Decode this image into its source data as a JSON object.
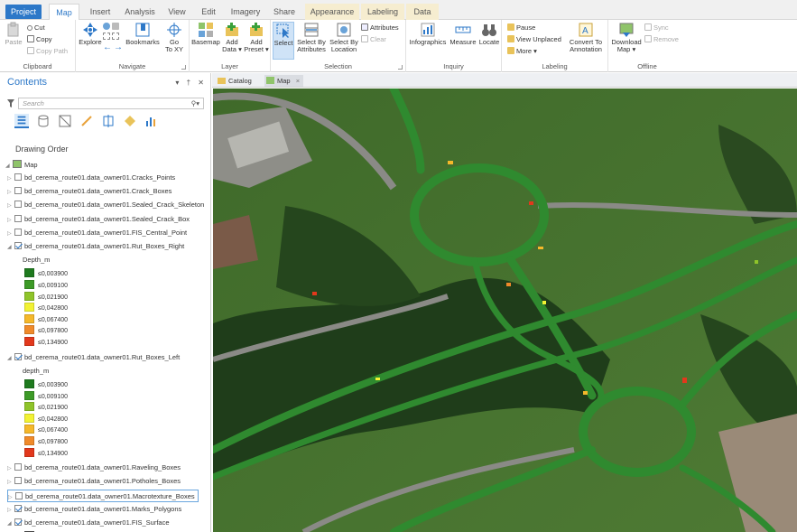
{
  "ribbon": {
    "tabs": [
      "Project",
      "Map",
      "Insert",
      "Analysis",
      "View",
      "Edit",
      "Imagery",
      "Share",
      "Appearance",
      "Labeling",
      "Data"
    ],
    "clipboard": {
      "paste": "Paste",
      "cut": "Cut",
      "copy": "Copy",
      "copy_path": "Copy Path",
      "label": "Clipboard"
    },
    "navigate": {
      "explore": "Explore",
      "bookmarks": "Bookmarks",
      "go_to_xy_1": "Go",
      "go_to_xy_2": "To XY",
      "label": "Navigate"
    },
    "layer": {
      "basemap": "Basemap",
      "add_data_1": "Add",
      "add_data_2": "Data ▾",
      "add_preset_1": "Add",
      "add_preset_2": "Preset ▾",
      "label": "Layer"
    },
    "selection": {
      "select": "Select",
      "select_by_attr_1": "Select By",
      "select_by_attr_2": "Attributes",
      "select_by_loc_1": "Select By",
      "select_by_loc_2": "Location",
      "attributes": "Attributes",
      "clear": "Clear",
      "label": "Selection"
    },
    "inquiry": {
      "infographics": "Infographics",
      "measure": "Measure",
      "locate": "Locate",
      "label": "Inquiry"
    },
    "labeling": {
      "pause": "Pause",
      "view_unplaced": "View Unplaced",
      "more": "More ▾",
      "convert_1": "Convert To",
      "convert_2": "Annotation",
      "label": "Labeling"
    },
    "offline": {
      "download_1": "Download",
      "download_2": "Map ▾",
      "sync": "Sync",
      "remove": "Remove",
      "label": "Offline"
    }
  },
  "contents": {
    "title": "Contents",
    "controls": "▾ † ✕",
    "search_placeholder": "Search",
    "drawing_order": "Drawing Order",
    "map_label": "Map",
    "layers_top": [
      "bd_cerema_route01.data_owner01.Cracks_Points",
      "bd_cerema_route01.data_owner01.Crack_Boxes",
      "bd_cerema_route01.data_owner01.Sealed_Crack_Skeleton",
      "bd_cerema_route01.data_owner01.Sealed_Crack_Box",
      "bd_cerema_route01.data_owner01.FIS_Central_Point"
    ],
    "rut_right": {
      "name": "bd_cerema_route01.data_owner01.Rut_Boxes_Right",
      "field": "Depth_m",
      "classes": [
        "≤0,003900",
        "≤0,009100",
        "≤0,021900",
        "≤0,042800",
        "≤0,067400",
        "≤0,097800",
        "≤0,134900"
      ]
    },
    "rut_left": {
      "name": "bd_cerema_route01.data_owner01.Rut_Boxes_Left",
      "field": "depth_m",
      "classes": [
        "≤0,003900",
        "≤0,009100",
        "≤0,021900",
        "≤0,042800",
        "≤0,067400",
        "≤0,097800",
        "≤0,134900"
      ]
    },
    "layers_bottom": [
      "bd_cerema_route01.data_owner01.Raveling_Boxes",
      "bd_cerema_route01.data_owner01.Potholes_Boxes",
      "bd_cerema_route01.data_owner01.Macrotexture_Boxes",
      "bd_cerema_route01.data_owner01.Marks_Polygons",
      "bd_cerema_route01.data_owner01.FIS_Surface"
    ]
  },
  "doc_tabs": {
    "catalog": "Catalog",
    "map": "Map"
  },
  "colors": {
    "accent": "#2d78c8",
    "classes": [
      "#1e7a1e",
      "#3d9a27",
      "#8fc42a",
      "#f2f233",
      "#f5b82a",
      "#f08a2a",
      "#e2381c"
    ]
  }
}
